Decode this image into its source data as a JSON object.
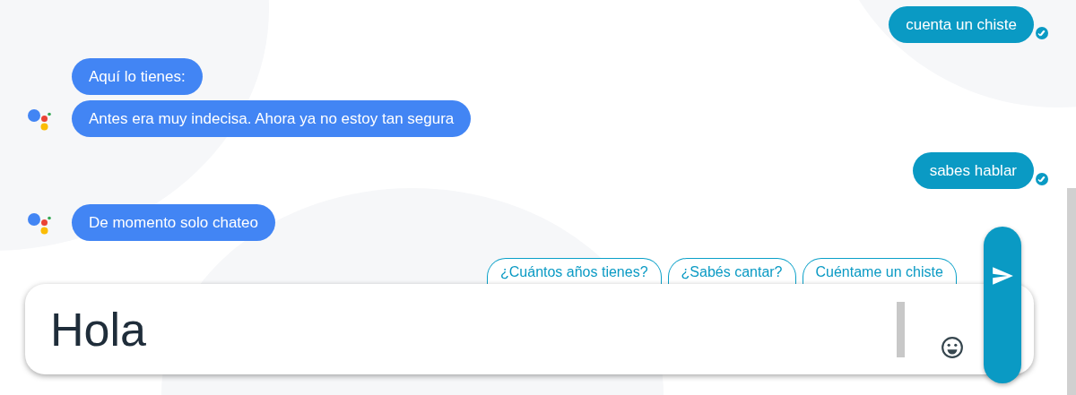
{
  "messages": [
    {
      "kind": "user",
      "text": "cuenta un chiste",
      "read": true,
      "avatar": false
    },
    {
      "kind": "assistant",
      "text": "Aquí lo tienes:",
      "read": false,
      "avatar": false
    },
    {
      "kind": "assistant",
      "text": "Antes era muy indecisa. Ahora ya no estoy tan segura",
      "read": false,
      "avatar": true
    },
    {
      "kind": "user",
      "text": "sabes hablar",
      "read": true,
      "avatar": false
    },
    {
      "kind": "assistant",
      "text": "De momento solo chateo",
      "read": false,
      "avatar": true
    }
  ],
  "suggestions": [
    "¿Cuántos años tienes?",
    "¿Sabés cantar?",
    "Cuéntame un chiste"
  ],
  "input": {
    "value": "Hola"
  }
}
